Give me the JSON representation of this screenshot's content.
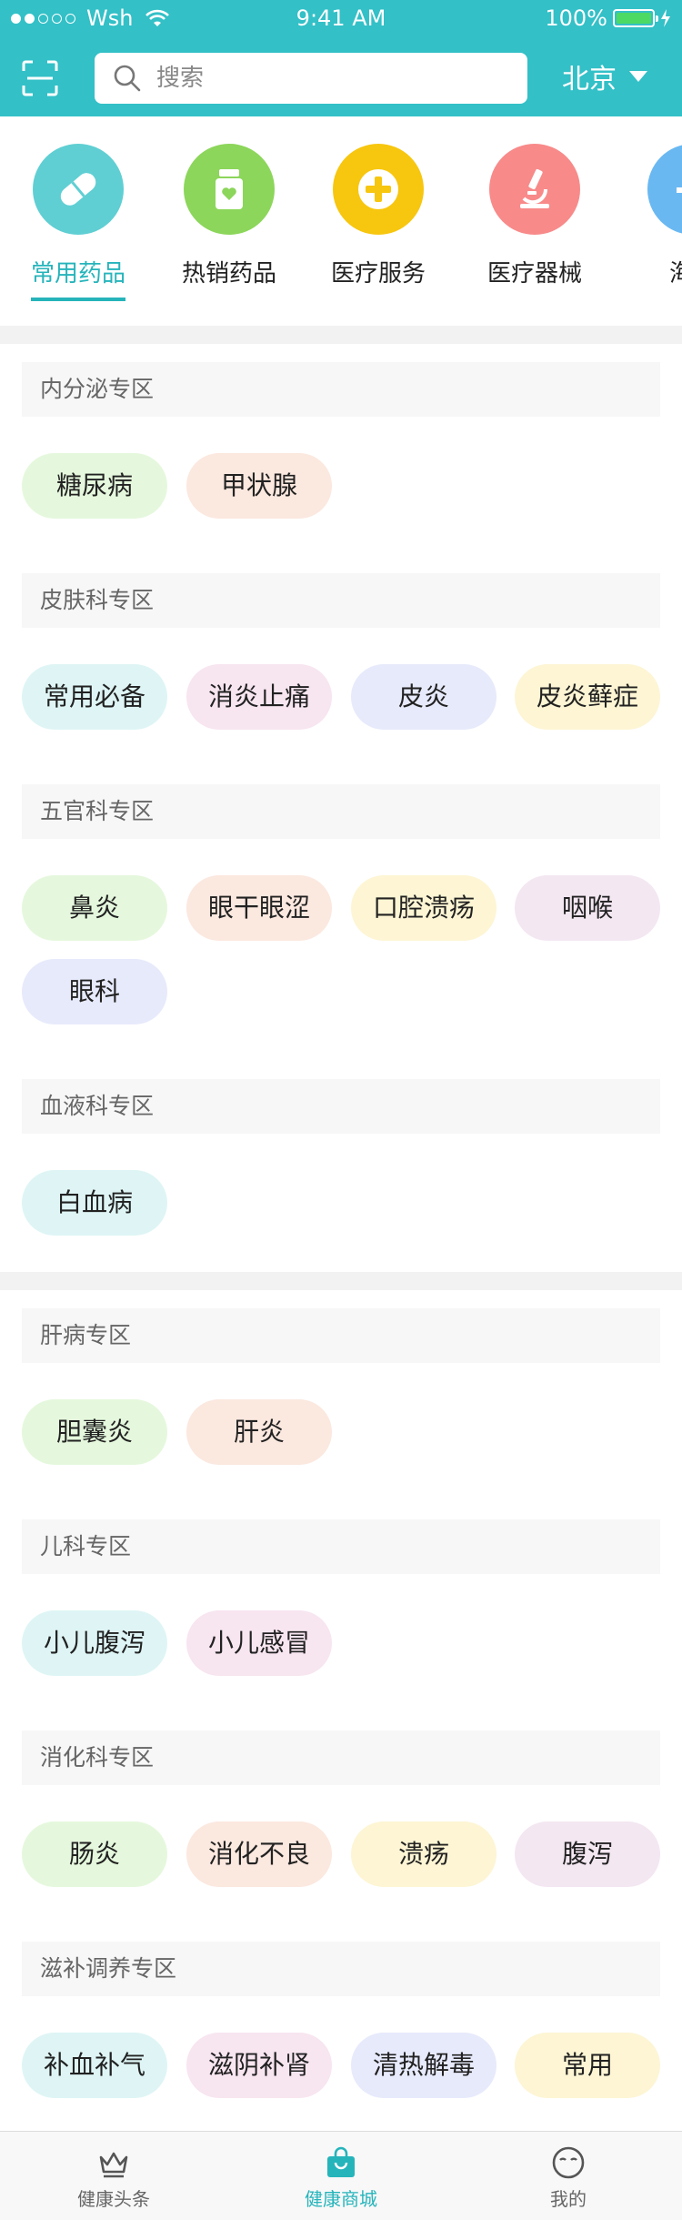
{
  "status_bar": {
    "carrier": "Wsh",
    "time": "9:41 AM",
    "battery": "100%",
    "battery_level": 1.0,
    "signal_bars_filled": 2,
    "signal_bars_total": 5
  },
  "header": {
    "search_placeholder": "搜索",
    "city": "北京"
  },
  "categories": [
    {
      "label": "常用药品",
      "icon": "pill-icon",
      "color": "#5fcfd3",
      "active": true
    },
    {
      "label": "热销药品",
      "icon": "medicine-bottle-icon",
      "color": "#8cd65b",
      "active": false
    },
    {
      "label": "医疗服务",
      "icon": "medical-cross-icon",
      "color": "#f7c60f",
      "active": false
    },
    {
      "label": "医疗器械",
      "icon": "microscope-icon",
      "color": "#f88a8a",
      "active": false
    },
    {
      "label": "海外",
      "icon": "airplane-icon",
      "color": "#6ab8f2",
      "active": false
    }
  ],
  "zones": [
    {
      "title": "内分泌专区",
      "chips": [
        "糖尿病",
        "甲状腺"
      ]
    },
    {
      "title": "皮肤科专区",
      "chips": [
        "常用必备",
        "消炎止痛",
        "皮炎",
        "皮炎藓症"
      ]
    },
    {
      "title": "五官科专区",
      "chips": [
        "鼻炎",
        "眼干眼涩",
        "口腔溃疡",
        "咽喉",
        "眼科"
      ]
    },
    {
      "title": "血液科专区",
      "chips": [
        "白血病"
      ]
    },
    {
      "title": "肝病专区",
      "chips": [
        "胆囊炎",
        "肝炎"
      ]
    },
    {
      "title": "儿科专区",
      "chips": [
        "小儿腹泻",
        "小儿感冒"
      ]
    },
    {
      "title": "消化科专区",
      "chips": [
        "肠炎",
        "消化不良",
        "溃疡",
        "腹泻"
      ]
    },
    {
      "title": "滋补调养专区",
      "chips": [
        "补血补气",
        "滋阴补肾",
        "清热解毒",
        "常用"
      ]
    }
  ],
  "tabbar": [
    {
      "label": "健康头条",
      "icon": "crown-icon",
      "active": false
    },
    {
      "label": "健康商城",
      "icon": "shopping-bag-icon",
      "active": true
    },
    {
      "label": "我的",
      "icon": "smiley-face-icon",
      "active": false
    }
  ],
  "colors": {
    "primary": "#33c0c7",
    "accent": "#26b4bb"
  }
}
